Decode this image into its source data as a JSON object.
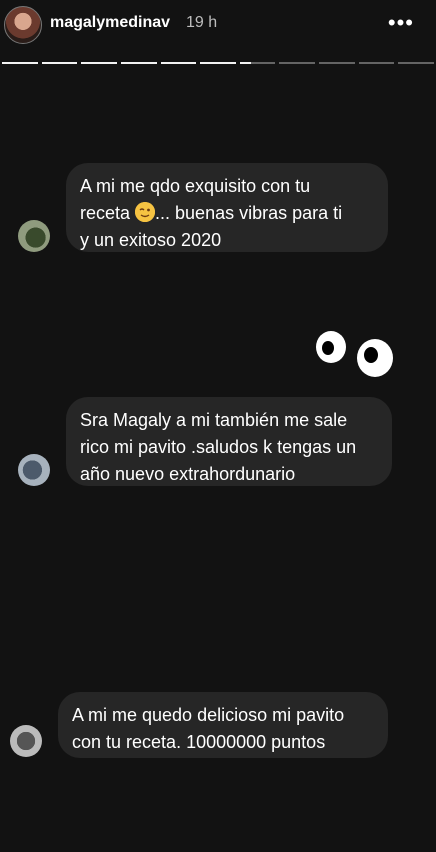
{
  "header": {
    "username": "magalymedinav",
    "time": "19 h",
    "more_icon": "more-horizontal-icon"
  },
  "progress": {
    "segments_total": 11,
    "segments_done": 6,
    "current_fraction": 0.3
  },
  "comments": [
    {
      "line1": "A mi me qdo exquisito con tu",
      "line2_pre": "receta ",
      "line2_post": "... buenas vibras para ti",
      "line3": "y un exitoso 2020",
      "emoji_icon": "winking-face-emoji-icon"
    },
    {
      "line1": "Sra Magaly a mi también me sale",
      "line2": "rico mi pavito .saludos k tengas un",
      "line3": "año nuevo extrahordunario"
    },
    {
      "line1": "A mi me quedo delicioso mi pavito",
      "line2": "con tu receta. 10000000 puntos"
    }
  ],
  "sticker": {
    "icon": "googly-eyes-sticker"
  }
}
